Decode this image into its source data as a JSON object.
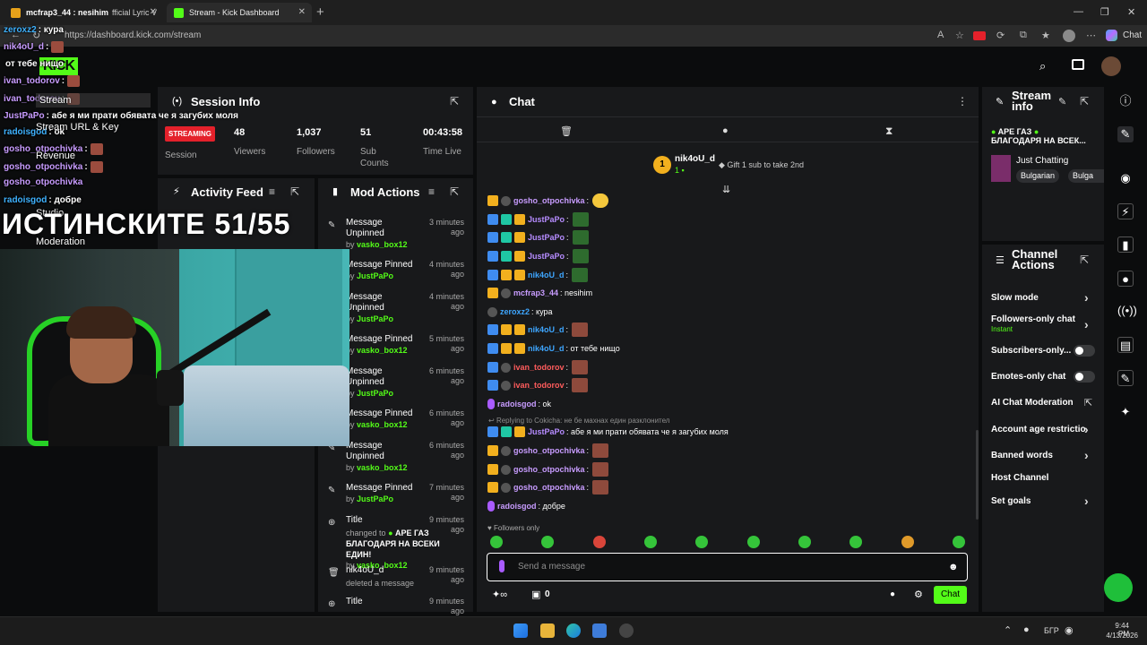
{
  "browser": {
    "tab1_title": "mcfrap3_44 : nesihim",
    "tab1_suffix": "fficial Lyric V",
    "tab2_title": "Stream - Kick Dashboard",
    "url": "https://dashboard.kick.com/stream",
    "chat_button": "Chat"
  },
  "overlay": {
    "lines": [
      {
        "user": "zeroxz2",
        "text": ": кура"
      },
      {
        "user": "nik4oU_d",
        "text": ":"
      },
      {
        "user": "",
        "text": "от тебе нищо"
      },
      {
        "user": "ivan_todorov",
        "text": ":"
      },
      {
        "user": "ivan_todorov",
        "text": ":"
      },
      {
        "user": "JustPaPo",
        "text": ": абе я ми прати обявата че я загубих моля"
      },
      {
        "user": "radoisgod",
        "text": ": ok"
      },
      {
        "user": "gosho_otpochivka",
        "text": ":"
      },
      {
        "user": "gosho_otpochivka",
        "text": ":"
      },
      {
        "user": "gosho_otpochivka",
        "text": ""
      },
      {
        "user": "radoisgod",
        "text": ": добре"
      }
    ],
    "menu_stream": "Stream",
    "menu_url_key": "Stream URL & Key",
    "menu_revenue": "Revenue",
    "menu_studio": "Studio",
    "menu_moderation": "Moderation",
    "big_text": "ИСТИНСКИТЕ 51/55"
  },
  "session_info": {
    "title": "Session Info",
    "status": "STREAMING",
    "status_label": "Session",
    "viewers": "48",
    "viewers_label": "Viewers",
    "followers": "1,037",
    "followers_label": "Followers",
    "subs": "51",
    "subs_label_1": "Sub",
    "subs_label_2": "Counts",
    "time_live": "00:43:58",
    "time_label": "Time Live"
  },
  "activity_feed": {
    "title": "Activity Feed"
  },
  "mod_actions": {
    "title": "Mod Actions",
    "items": [
      {
        "line1": "Message",
        "line2": "Unpinned",
        "by": "vasko_box12",
        "time1": "3 minutes",
        "time2": "ago"
      },
      {
        "line1": "Message Pinned",
        "line2": "",
        "by": "JustPaPo",
        "time1": "4 minutes ago",
        "time2": ""
      },
      {
        "line1": "Message",
        "line2": "Unpinned",
        "by": "JustPaPo",
        "time1": "4 minutes",
        "time2": "ago"
      },
      {
        "line1": "Message Pinned",
        "line2": "",
        "by": "vasko_box12",
        "time1": "5 minutes ago",
        "time2": ""
      },
      {
        "line1": "Message",
        "line2": "Unpinned",
        "by": "JustPaPo",
        "time1": "6 minutes",
        "time2": "ago"
      },
      {
        "line1": "Message Pinned",
        "line2": "",
        "by": "vasko_box12",
        "time1": "6 minutes ago",
        "time2": ""
      },
      {
        "line1": "Message",
        "line2": "Unpinned",
        "by": "vasko_box12",
        "time1": "6 minutes",
        "time2": "ago"
      },
      {
        "line1": "Message Pinned",
        "line2": "",
        "by": "JustPaPo",
        "time1": "7 minutes ago",
        "time2": ""
      },
      {
        "line1": "Title",
        "line2": "",
        "by": "vasko_box12",
        "time1": "9 minutes ago",
        "time2": ""
      },
      {
        "line1": "nik4oU_d",
        "line2": "",
        "by": "",
        "time1": "9 minutes ago",
        "time2": ""
      },
      {
        "line1": "Title",
        "line2": "",
        "by": "",
        "time1": "9 minutes ago",
        "time2": ""
      }
    ],
    "by_label": "by",
    "title_changed": "changed to",
    "title_value": "APE ГАЗ",
    "title_value2": "БЛАГОДАРЯ НА ВСЕКИ ЕДИН!",
    "deleted": "deleted a message"
  },
  "chat": {
    "title": "Chat",
    "pinned_user": "nik4oU_d",
    "pinned_count": "1",
    "gift_text": "Gift 1 sub to take 2nd",
    "messages": [
      {
        "user": "gosho_otpochivka",
        "text": ":"
      },
      {
        "user": "JustPaPo",
        "text": ":"
      },
      {
        "user": "JustPaPo",
        "text": ":"
      },
      {
        "user": "JustPaPo",
        "text": ":"
      },
      {
        "user": "nik4oU_d",
        "text": ":"
      },
      {
        "user": "mcfrap3_44",
        "text": ": nesihim"
      },
      {
        "user": "zeroxz2",
        "text": ": кура"
      },
      {
        "user": "nik4oU_d",
        "text": ":"
      },
      {
        "user": "nik4oU_d",
        "text": ": от тебе нищо"
      },
      {
        "user": "ivan_todorov",
        "text": ":"
      },
      {
        "user": "ivan_todorov",
        "text": ":"
      },
      {
        "user": "radoisgod",
        "text": ": ok"
      },
      {
        "user": "JustPaPo",
        "text": ": абе я ми прати обявата че я загубих моля"
      },
      {
        "user": "gosho_otpochivka",
        "text": ":"
      },
      {
        "user": "gosho_otpochivka",
        "text": ":"
      },
      {
        "user": "gosho_otpochivka",
        "text": ":"
      },
      {
        "user": "radoisgod",
        "text": ": добре"
      }
    ],
    "reply_text": "Replying to Cokicha: не бе махнах един разклонител",
    "followers_only": "Followers only",
    "input_placeholder": "Send a message",
    "points": "0",
    "send_button": "Chat"
  },
  "stream_info": {
    "title_1": "Stream",
    "title_2": "info",
    "stream_title_1": "APE ГАЗ",
    "stream_title_2": "БЛАГОДАРЯ НА ВСЕК...",
    "category": "Just Chatting",
    "tag1": "Bulgarian",
    "tag2": "Bulga"
  },
  "channel_actions": {
    "title_1": "Channel",
    "title_2": "Actions",
    "slow_mode": "Slow mode",
    "followers_only": "Followers-only chat",
    "followers_only_sub": "Instant",
    "subscribers_only": "Subscribers-only...",
    "emotes_only": "Emotes-only chat",
    "ai_moderation": "AI Chat Moderation",
    "account_age": "Account age restrictio",
    "banned_words": "Banned words",
    "host_channel": "Host Channel",
    "set_goals": "Set goals"
  },
  "taskbar": {
    "lang": "БГР",
    "time": "9:44 PM",
    "date": "4/13/2026"
  },
  "colors": {
    "kick_green": "#53fc18",
    "panel_bg": "#18191b",
    "streaming_red": "#e4212b"
  }
}
